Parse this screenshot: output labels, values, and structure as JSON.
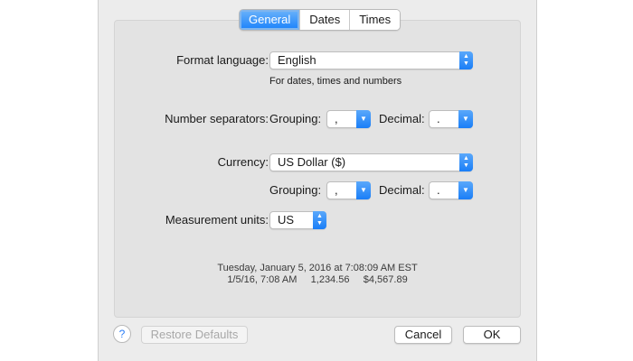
{
  "tabs": [
    {
      "label": "General",
      "active": true
    },
    {
      "label": "Dates",
      "active": false
    },
    {
      "label": "Times",
      "active": false
    }
  ],
  "format_language": {
    "label": "Format language:",
    "value": "English",
    "hint": "For dates, times and numbers"
  },
  "number_separators": {
    "label": "Number separators:",
    "grouping_label": "Grouping:",
    "grouping_value": ",",
    "decimal_label": "Decimal:",
    "decimal_value": "."
  },
  "currency": {
    "label": "Currency:",
    "value": "US Dollar ($)",
    "grouping_label": "Grouping:",
    "grouping_value": ",",
    "decimal_label": "Decimal:",
    "decimal_value": "."
  },
  "measurement": {
    "label": "Measurement units:",
    "value": "US"
  },
  "sample": {
    "line1": "Tuesday, January 5, 2016 at 7:08:09 AM EST",
    "line2": "1/5/16, 7:08 AM     1,234.56     $4,567.89"
  },
  "buttons": {
    "help": "?",
    "restore": "Restore Defaults",
    "cancel": "Cancel",
    "ok": "OK"
  },
  "colors": {
    "accent": "#1a82fb",
    "panel": "#e3e3e3",
    "window": "#ececec"
  }
}
